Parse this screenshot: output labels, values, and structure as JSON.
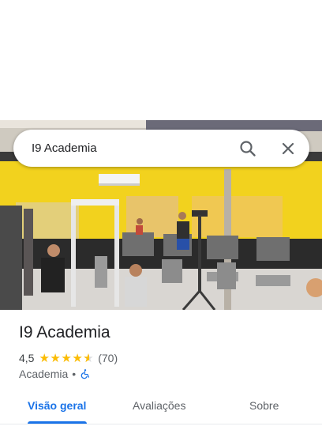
{
  "search": {
    "query": "I9 Academia"
  },
  "place": {
    "name": "I9 Academia",
    "rating": "4,5",
    "rating_value": 4.5,
    "reviews_count": "(70)",
    "category": "Academia",
    "separator": "•"
  },
  "tabs": [
    {
      "label": "Visão geral",
      "active": true
    },
    {
      "label": "Avaliações",
      "active": false
    },
    {
      "label": "Sobre",
      "active": false
    }
  ],
  "icons": {
    "search": "search-icon",
    "clear": "close-icon",
    "accessibility": "wheelchair-icon"
  },
  "colors": {
    "accent": "#1a73e8",
    "star": "#fbbc04",
    "wall": "#f2d21e"
  }
}
